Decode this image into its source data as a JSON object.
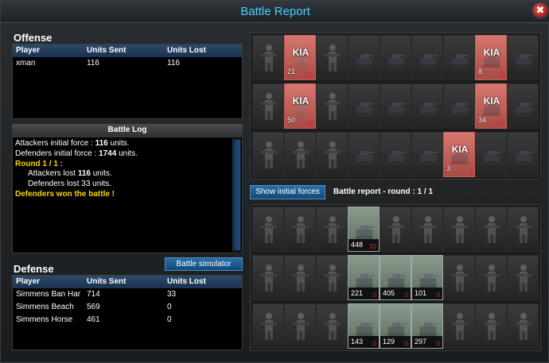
{
  "window": {
    "title": "Battle Report",
    "close_label": "✖"
  },
  "offense": {
    "title": "Offense",
    "headers": [
      "Player",
      "Units Sent",
      "Units Lost"
    ],
    "rows": [
      {
        "player": "xman",
        "sent": "116",
        "lost": "116"
      }
    ]
  },
  "battle_log": {
    "title": "Battle Log",
    "attackers_prefix": "Attackers initial force : ",
    "attackers_value": "116",
    "attackers_suffix": " units.",
    "defenders_prefix": "Defenders initial force : ",
    "defenders_value": "1744",
    "defenders_suffix": " units.",
    "round": "Round 1 / 1 :",
    "attackers_lost_prefix": "Attackers lost ",
    "attackers_lost_value": "116",
    "attackers_lost_suffix": " units.",
    "defenders_lost": "Defenders lost 33 units.",
    "result": "Defenders won the battle !"
  },
  "defense": {
    "title": "Defense",
    "headers": [
      "Player",
      "Units Sent",
      "Units Lost"
    ],
    "rows": [
      {
        "player": "Simmens Ban Har",
        "sent": "714",
        "lost": "33"
      },
      {
        "player": "Simmens Beach",
        "sent": "569",
        "lost": "0"
      },
      {
        "player": "Simmens Horse",
        "sent": "461",
        "lost": "0"
      }
    ]
  },
  "buttons": {
    "battle_simulator": "Battle simulator",
    "show_initial_forces": "Show initial forces"
  },
  "report": {
    "round_label": "Battle report - round : 1 / 1"
  },
  "attacker_grid": {
    "kia_label": "KIA",
    "kia_tiles": [
      {
        "row": 0,
        "col": 1,
        "count": "21",
        "lost": "21"
      },
      {
        "row": 0,
        "col": 7,
        "count": "8",
        "lost": "8"
      },
      {
        "row": 1,
        "col": 1,
        "count": "50",
        "lost": "50"
      },
      {
        "row": 1,
        "col": 7,
        "count": "34",
        "lost": "34"
      },
      {
        "row": 2,
        "col": 6,
        "count": "3",
        "lost": "3"
      }
    ]
  },
  "defender_grid": {
    "unit_tiles": [
      {
        "row": 0,
        "col": 3,
        "count": "448",
        "lost": "33"
      },
      {
        "row": 1,
        "col": 3,
        "count": "221",
        "lost": "0"
      },
      {
        "row": 1,
        "col": 4,
        "count": "405",
        "lost": "0"
      },
      {
        "row": 1,
        "col": 5,
        "count": "101",
        "lost": "0"
      },
      {
        "row": 2,
        "col": 3,
        "count": "143",
        "lost": "0"
      },
      {
        "row": 2,
        "col": 4,
        "count": "129",
        "lost": "0"
      },
      {
        "row": 2,
        "col": 5,
        "count": "297",
        "lost": "0"
      }
    ]
  },
  "colors": {
    "title": "#5fc8f0",
    "kia_tile": "#d87770",
    "yellow_text": "#ffd400",
    "lost_red": "#e02020"
  }
}
